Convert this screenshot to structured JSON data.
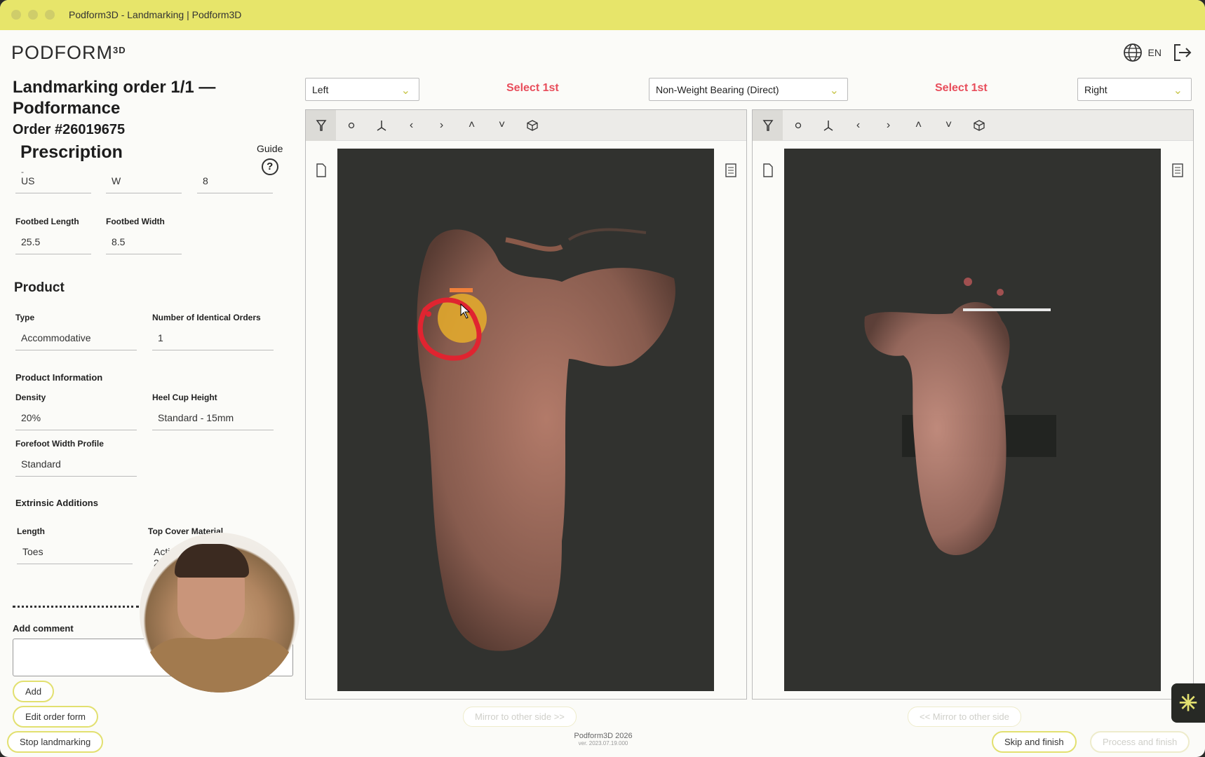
{
  "window": {
    "title": "Podform3D - Landmarking | Podform3D"
  },
  "header": {
    "logo": "PODFORM",
    "logo_sup": "3D",
    "language": "EN"
  },
  "order": {
    "title": "Landmarking order 1/1 — Podformance",
    "number": "Order #26019675",
    "prescription_heading": "Prescription",
    "guide_label": "Guide",
    "guide_symbol": "?",
    "stray_dash": "-"
  },
  "prescription": {
    "size_system": "US",
    "width": "W",
    "size": "8",
    "footbed_length_label": "Footbed Length",
    "footbed_length": "25.5",
    "footbed_width_label": "Footbed Width",
    "footbed_width": "8.5"
  },
  "product": {
    "heading": "Product",
    "type_label": "Type",
    "type": "Accommodative",
    "identical_orders_label": "Number of Identical Orders",
    "identical_orders": "1"
  },
  "product_info": {
    "heading": "Product Information",
    "density_label": "Density",
    "density": "20%",
    "heel_cup_label": "Heel Cup Height",
    "heel_cup": "Standard - 15mm",
    "forefoot_label": "Forefoot Width Profile",
    "forefoot": "Standard"
  },
  "extrinsic": {
    "heading": "Extrinsic Additions",
    "length_label": "Length",
    "length": "Toes",
    "top_cover_label": "Top Cover Material",
    "top_cover": "Acti",
    "top_cover_line2": "2"
  },
  "comment": {
    "label": "Add comment",
    "value": ""
  },
  "buttons": {
    "add": "Add",
    "edit_order_form": "Edit order form",
    "stop_landmarking": "Stop landmarking",
    "skip_and_finish": "Skip and finish",
    "process_and_finish": "Process and finish",
    "mirror_right": "Mirror to other side >>",
    "mirror_left": "<< Mirror to other side"
  },
  "toolbar": {
    "left_side": "Left",
    "right_side": "Right",
    "select_left": "Select 1st",
    "select_right": "Select 1st",
    "bearing": "Non-Weight Bearing (Direct)"
  },
  "footer": {
    "copyright": "Podform3D 2026",
    "version": "ver. 2023.07.19.000"
  },
  "colors": {
    "accent": "#e7e56a",
    "select_red": "#e84d5b",
    "canvas_bg": "#31322f"
  }
}
